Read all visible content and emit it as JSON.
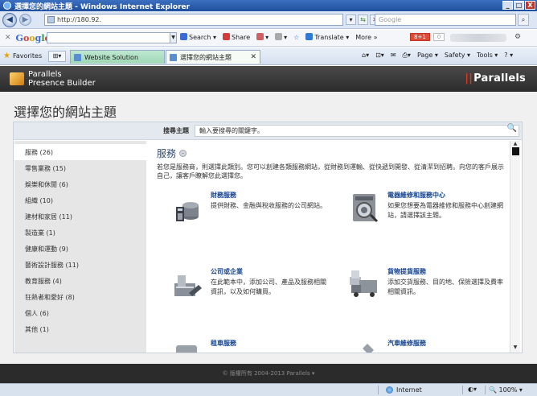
{
  "window": {
    "title": "選擇您的網站主題 - Windows Internet Explorer",
    "buttons": [
      "_",
      "□",
      "X"
    ]
  },
  "address": {
    "url": "http://180.92.",
    "search_placeholder": "Google"
  },
  "google_toolbar": {
    "logo": [
      "G",
      "o",
      "o",
      "g",
      "l",
      "e"
    ],
    "items": [
      {
        "label": "Search",
        "color": "#3b6ad6"
      },
      {
        "label": "Share",
        "color": "#d63b3b"
      },
      {
        "label": "Translate",
        "color": "#2f7ad6"
      },
      {
        "label": "More »",
        "color": ""
      }
    ],
    "plus_label": "8+1",
    "plus_count": "0"
  },
  "favbar": {
    "favorites_label": "Favorites",
    "tabs": [
      {
        "label": "Website Solution"
      },
      {
        "label": "選擇您的網站主題"
      }
    ],
    "commands": [
      "Page ▾",
      "Safety ▾",
      "Tools ▾",
      "? ▾"
    ]
  },
  "builder": {
    "product_line1": "Parallels",
    "product_line2": "Presence Builder",
    "brand": "Parallels",
    "page_title": "選擇您的網站主題",
    "search_label": "搜尋主題",
    "search_placeholder": "輸入要搜尋的關鍵字。",
    "categories": [
      {
        "label": "服務 (26)",
        "active": true
      },
      {
        "label": "零售業務 (15)"
      },
      {
        "label": "娛樂和休閒 (6)"
      },
      {
        "label": "組織 (10)"
      },
      {
        "label": "建材和家居 (11)"
      },
      {
        "label": "製造業 (1)"
      },
      {
        "label": "健康和運動 (9)"
      },
      {
        "label": "藝術設計服務 (11)"
      },
      {
        "label": "教育服務 (4)"
      },
      {
        "label": "狂熱者和愛好 (8)"
      },
      {
        "label": "個人 (6)"
      },
      {
        "label": "其他 (1)"
      }
    ],
    "section_title": "服務",
    "section_desc": "若您是服務商，則選擇此類別。您可以創建各類服務網站，從財務到運輸、從快遞到開發、從清潔到招聘。向您的客戶展示自己，讓客戶瞭解您此選擇您。",
    "templates": [
      {
        "name": "財務服務",
        "desc": "提供財務、金融與稅收服務的公司網站。",
        "icon": "finance-icon"
      },
      {
        "name": "電器維修和服務中心",
        "desc": "如果您想要為電器維修和服務中心創建網站，請選擇該主題。",
        "icon": "appliance-icon"
      },
      {
        "name": "公司或企業",
        "desc": "在此範本中，添加公司、產品及服務相關資訊，以及如何購買。",
        "icon": "company-icon"
      },
      {
        "name": "貨物提貨服務",
        "desc": "添加交貨服務、目的地、保險選擇及費率相關資訊。",
        "icon": "truck-icon"
      },
      {
        "name": "租車服務",
        "desc": "",
        "icon": "car-rental-icon"
      },
      {
        "name": "汽車維修服務",
        "desc": "",
        "icon": "car-repair-icon"
      }
    ],
    "footer": "© 版權所有 2004-2013 Parallels ▾"
  },
  "statusbar": {
    "zone": "Internet",
    "zoom": "100%"
  }
}
